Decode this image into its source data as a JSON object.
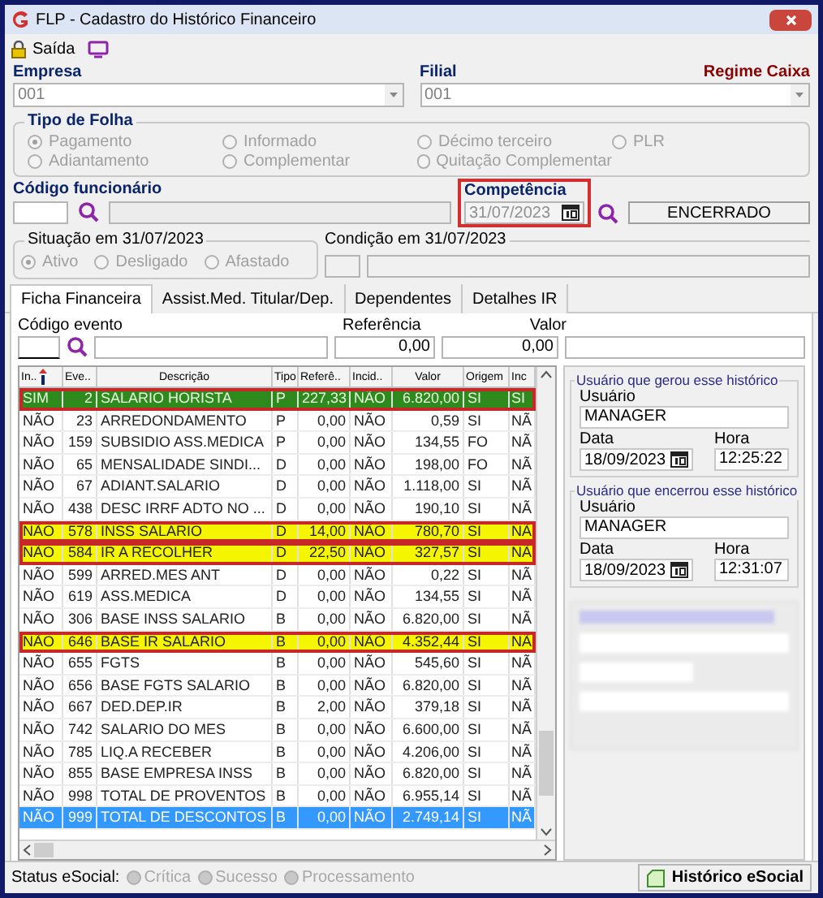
{
  "window": {
    "title": "FLP - Cadastro do Histórico Financeiro"
  },
  "toolbar": {
    "exit_label": "Saída"
  },
  "empresa": {
    "label": "Empresa",
    "value": "001"
  },
  "filial": {
    "label": "Filial",
    "value": "001"
  },
  "regime": "Regime Caixa",
  "tipo_folha": {
    "title": "Tipo de Folha",
    "options": [
      {
        "label": "Pagamento",
        "selected": true
      },
      {
        "label": "Informado",
        "selected": false
      },
      {
        "label": "Décimo terceiro",
        "selected": false
      },
      {
        "label": "PLR",
        "selected": false
      },
      {
        "label": "Adiantamento",
        "selected": false
      },
      {
        "label": "Complementar",
        "selected": false
      },
      {
        "label": "Quitação Complementar",
        "selected": false
      }
    ]
  },
  "funcionario": {
    "label": "Código funcionário"
  },
  "competencia": {
    "label": "Competência",
    "value": "31/07/2023",
    "outlined": true
  },
  "status_field": "ENCERRADO",
  "situacao": {
    "title": "Situação em 31/07/2023",
    "options": [
      {
        "label": "Ativo",
        "selected": true
      },
      {
        "label": "Desligado",
        "selected": false
      },
      {
        "label": "Afastado",
        "selected": false
      }
    ]
  },
  "condicao": {
    "title": "Condição em 31/07/2023"
  },
  "tabs": [
    {
      "label": "Ficha Financeira",
      "selected": true
    },
    {
      "label": "Assist.Med. Titular/Dep.",
      "selected": false
    },
    {
      "label": "Dependentes",
      "selected": false
    },
    {
      "label": "Detalhes IR",
      "selected": false
    }
  ],
  "evento": {
    "label": "Código evento",
    "referencia_label": "Referência",
    "referencia": "0,00",
    "valor_label": "Valor",
    "valor": "0,00"
  },
  "table": {
    "columns": [
      "In..",
      "Eve..",
      "Descrição",
      "Tipo",
      "Referê..",
      "Incid..",
      "Valor",
      "Origem",
      "Inc"
    ],
    "rows": [
      {
        "cells": [
          "SIM",
          "2",
          "SALARIO HORISTA",
          "P",
          "227,33",
          "NÃO",
          "6.820,00",
          "SI",
          "SI"
        ],
        "selected": false,
        "color": "#2f8a1e",
        "outlined": true
      },
      {
        "cells": [
          "NÃO",
          "23",
          "ARREDONDAMENTO",
          "P",
          "0,00",
          "NÃO",
          "0,59",
          "SI",
          "NÃ"
        ],
        "selected": false,
        "outlined": false
      },
      {
        "cells": [
          "NÃO",
          "159",
          "SUBSIDIO ASS.MEDICA",
          "P",
          "0,00",
          "NÃO",
          "134,55",
          "FO",
          "NÃ"
        ],
        "selected": false,
        "outlined": false
      },
      {
        "cells": [
          "NÃO",
          "65",
          "MENSALIDADE SINDI...",
          "D",
          "0,00",
          "NÃO",
          "198,00",
          "FO",
          "NÃ"
        ],
        "selected": false,
        "outlined": false
      },
      {
        "cells": [
          "NÃO",
          "67",
          "ADIANT.SALARIO",
          "D",
          "0,00",
          "NÃO",
          "1.118,00",
          "SI",
          "NÃ"
        ],
        "selected": false,
        "outlined": false
      },
      {
        "cells": [
          "NÃO",
          "438",
          "DESC IRRF ADTO NO ...",
          "D",
          "0,00",
          "NÃO",
          "190,10",
          "SI",
          "NÃ"
        ],
        "selected": false,
        "outlined": false
      },
      {
        "cells": [
          "NÃO",
          "578",
          "INSS SALARIO",
          "D",
          "14,00",
          "NÃO",
          "780,70",
          "SI",
          "NÃ"
        ],
        "selected": false,
        "color": "#f5f500",
        "outlined": true
      },
      {
        "cells": [
          "NÃO",
          "584",
          "IR A RECOLHER",
          "D",
          "22,50",
          "NÃO",
          "327,57",
          "SI",
          "NÃ"
        ],
        "selected": false,
        "color": "#f5f500",
        "outlined": true
      },
      {
        "cells": [
          "NÃO",
          "599",
          "ARRED.MES ANT",
          "D",
          "0,00",
          "NÃO",
          "0,22",
          "SI",
          "NÃ"
        ],
        "selected": false,
        "outlined": false
      },
      {
        "cells": [
          "NÃO",
          "619",
          "ASS.MEDICA",
          "D",
          "0,00",
          "NÃO",
          "134,55",
          "SI",
          "NÃ"
        ],
        "selected": false,
        "outlined": false
      },
      {
        "cells": [
          "NÃO",
          "306",
          "BASE INSS SALARIO",
          "B",
          "0,00",
          "NÃO",
          "6.820,00",
          "SI",
          "NÃ"
        ],
        "selected": false,
        "outlined": false
      },
      {
        "cells": [
          "NÃO",
          "646",
          "BASE IR SALARIO",
          "B",
          "0,00",
          "NÃO",
          "4.352,44",
          "SI",
          "NÃ"
        ],
        "selected": false,
        "color": "#f5f500",
        "outlined": true
      },
      {
        "cells": [
          "NÃO",
          "655",
          "FGTS",
          "B",
          "0,00",
          "NÃO",
          "545,60",
          "SI",
          "NÃ"
        ],
        "selected": false,
        "outlined": false
      },
      {
        "cells": [
          "NÃO",
          "656",
          "BASE FGTS SALARIO",
          "B",
          "0,00",
          "NÃO",
          "6.820,00",
          "SI",
          "NÃ"
        ],
        "selected": false,
        "outlined": false
      },
      {
        "cells": [
          "NÃO",
          "667",
          "DED.DEP.IR",
          "B",
          "2,00",
          "NÃO",
          "379,18",
          "SI",
          "NÃ"
        ],
        "selected": false,
        "outlined": false
      },
      {
        "cells": [
          "NÃO",
          "742",
          "SALARIO DO MES",
          "B",
          "0,00",
          "NÃO",
          "6.600,00",
          "SI",
          "NÃ"
        ],
        "selected": false,
        "outlined": false
      },
      {
        "cells": [
          "NÃO",
          "785",
          "LIQ.A RECEBER",
          "B",
          "0,00",
          "NÃO",
          "4.206,00",
          "SI",
          "NÃ"
        ],
        "selected": false,
        "outlined": false
      },
      {
        "cells": [
          "NÃO",
          "855",
          "BASE EMPRESA INSS",
          "B",
          "0,00",
          "NÃO",
          "6.820,00",
          "SI",
          "NÃ"
        ],
        "selected": false,
        "outlined": false
      },
      {
        "cells": [
          "NÃO",
          "998",
          "TOTAL DE PROVENTOS",
          "B",
          "0,00",
          "NÃO",
          "6.955,14",
          "SI",
          "NÃ"
        ],
        "selected": false,
        "outlined": false
      },
      {
        "cells": [
          "NÃO",
          "999",
          "TOTAL DE DESCONTOS",
          "B",
          "0,00",
          "NÃO",
          "2.749,14",
          "SI",
          "NÃ"
        ],
        "selected": true,
        "outlined": false
      }
    ]
  },
  "user_groups": [
    {
      "title": "Usuário que gerou esse histórico",
      "user_label": "Usuário",
      "user": "MANAGER",
      "date_label": "Data",
      "date": "18/09/2023",
      "time_label": "Hora",
      "time": "12:25:22"
    },
    {
      "title": "Usuário que encerrou esse histórico",
      "user_label": "Usuário",
      "user": "MANAGER",
      "date_label": "Data",
      "date": "18/09/2023",
      "time_label": "Hora",
      "time": "12:31:07"
    }
  ],
  "status_bar": {
    "label": "Status eSocial:",
    "options": [
      "Crítica",
      "Sucesso",
      "Processamento"
    ],
    "button": "Histórico eSocial"
  }
}
